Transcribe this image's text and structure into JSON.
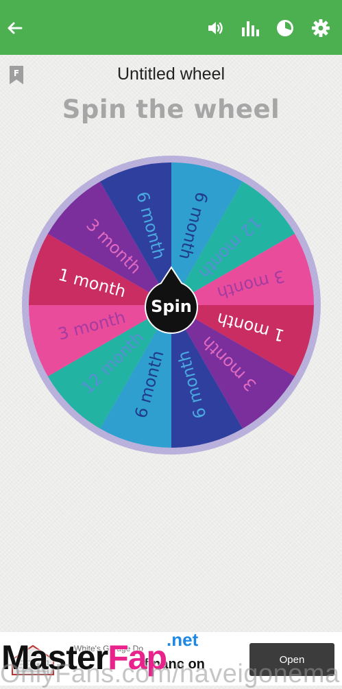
{
  "appbar": {
    "color": "#4caf50",
    "icons": [
      "back-arrow-icon",
      "volume-icon",
      "bar-chart-icon",
      "pie-chart-icon",
      "settings-gear-icon"
    ]
  },
  "bookmark_badge": "F",
  "wheel_title": "Untitled wheel",
  "subtitle": "Spin the wheel",
  "spin_label": "Spin",
  "wheel": {
    "segments": [
      {
        "label": "6 month",
        "color": "#2f9fcf",
        "text_color": "#203a8c"
      },
      {
        "label": "12 month",
        "color": "#23b3a2",
        "text_color": "#5a8fd8"
      },
      {
        "label": "3 month",
        "color": "#ea4c9c",
        "text_color": "#a33ba0"
      },
      {
        "label": "1 month",
        "color": "#c92d61",
        "text_color": "#ffffff"
      },
      {
        "label": "3 month",
        "color": "#7a2f9c",
        "text_color": "#e06ac0"
      },
      {
        "label": "6 month",
        "color": "#2f3f9e",
        "text_color": "#4aa9e0"
      },
      {
        "label": "6 month",
        "color": "#2f9fcf",
        "text_color": "#203a8c"
      },
      {
        "label": "12 month",
        "color": "#23b3a2",
        "text_color": "#5a8fd8"
      },
      {
        "label": "3 month",
        "color": "#ea4c9c",
        "text_color": "#a33ba0"
      },
      {
        "label": "1 month",
        "color": "#c92d61",
        "text_color": "#ffffff"
      },
      {
        "label": "3 month",
        "color": "#7a2f9c",
        "text_color": "#e06ac0"
      },
      {
        "label": "6 month",
        "color": "#2f3f9e",
        "text_color": "#4aa9e0"
      }
    ]
  },
  "ad": {
    "advertiser": "White's Garage Do",
    "headline": "financ on",
    "button_label": "Open"
  },
  "watermark": {
    "master": "Master",
    "fap": "Fap",
    "net": ".net",
    "url": "OnlyFans.com/haveigonema"
  }
}
